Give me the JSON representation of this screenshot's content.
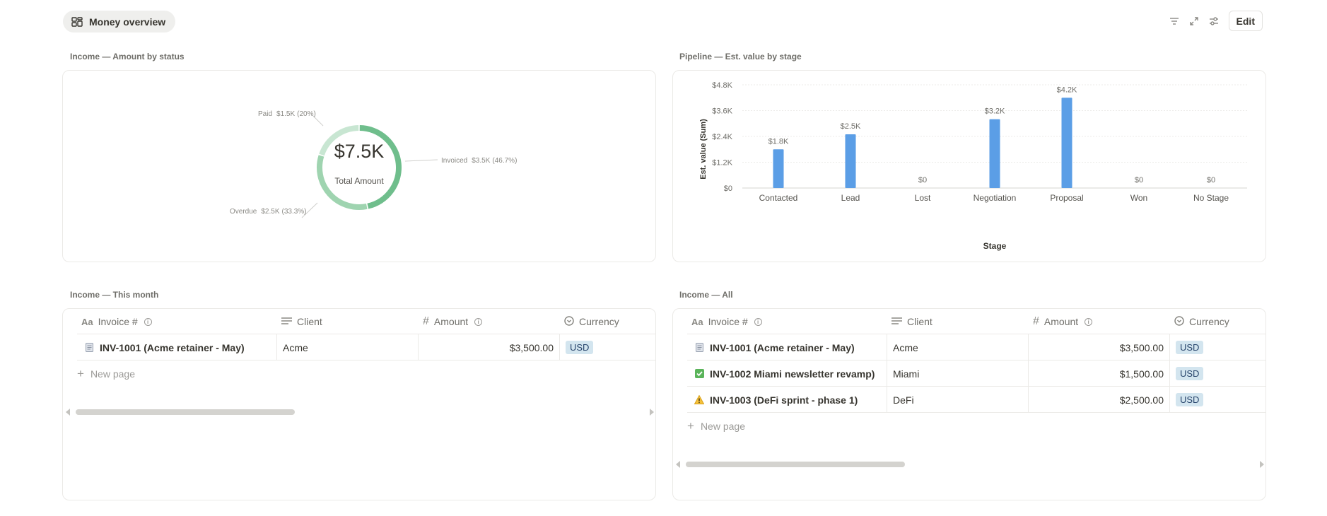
{
  "tab": {
    "label": "Money overview"
  },
  "toolbar": {
    "edit_label": "Edit"
  },
  "income_status": {
    "title": "Income — Amount by status",
    "center_value": "$7.5K",
    "center_label": "Total Amount",
    "slices": [
      {
        "label": "Invoiced",
        "amount": "$3.5K",
        "percent_text": "(46.7%)",
        "percent": 46.7,
        "color": "#6fbe8c"
      },
      {
        "label": "Overdue",
        "amount": "$2.5K",
        "percent_text": "(33.3%)",
        "percent": 33.3,
        "color": "#9fd4b0"
      },
      {
        "label": "Paid",
        "amount": "$1.5K",
        "percent_text": "(20%)",
        "percent": 20.0,
        "color": "#c8e6d2"
      }
    ]
  },
  "pipeline": {
    "title": "Pipeline — Est. value by stage"
  },
  "chart_data": {
    "type": "bar",
    "title": "Pipeline — Est. value by stage",
    "xlabel": "Stage",
    "ylabel": "Est. value (Sum)",
    "categories": [
      "Contacted",
      "Lead",
      "Lost",
      "Negotiation",
      "Proposal",
      "Won",
      "No Stage"
    ],
    "values": [
      1800,
      2500,
      0,
      3200,
      4200,
      0,
      0
    ],
    "value_labels": [
      "$1.8K",
      "$2.5K",
      "$0",
      "$3.2K",
      "$4.2K",
      "$0",
      "$0"
    ],
    "yticks": [
      0,
      1200,
      2400,
      3600,
      4800
    ],
    "ytick_labels": [
      "$0",
      "$1.2K",
      "$2.4K",
      "$3.6K",
      "$4.8K"
    ],
    "ylim": [
      0,
      4800
    ],
    "grid": true,
    "bar_color": "#5b9ee6"
  },
  "income_month": {
    "title": "Income — This month",
    "columns": [
      "Invoice #",
      "Client",
      "Amount",
      "Currency"
    ],
    "rows": [
      {
        "icon": "page-icon",
        "invoice": "INV-1001 (Acme retainer - May)",
        "client": "Acme",
        "amount": "$3,500.00",
        "currency": "USD"
      }
    ],
    "new_page": "New page"
  },
  "income_all": {
    "title": "Income — All",
    "columns": [
      "Invoice #",
      "Client",
      "Amount",
      "Currency"
    ],
    "rows": [
      {
        "icon": "page-icon",
        "invoice": "INV-1001 (Acme retainer - May)",
        "client": "Acme",
        "amount": "$3,500.00",
        "currency": "USD"
      },
      {
        "icon": "check-icon",
        "invoice": "INV-1002 Miami newsletter revamp)",
        "client": "Miami",
        "amount": "$1,500.00",
        "currency": "USD"
      },
      {
        "icon": "warning-icon",
        "invoice": "INV-1003 (DeFi sprint - phase 1)",
        "client": "DeFi",
        "amount": "$2,500.00",
        "currency": "USD"
      }
    ],
    "new_page": "New page"
  }
}
